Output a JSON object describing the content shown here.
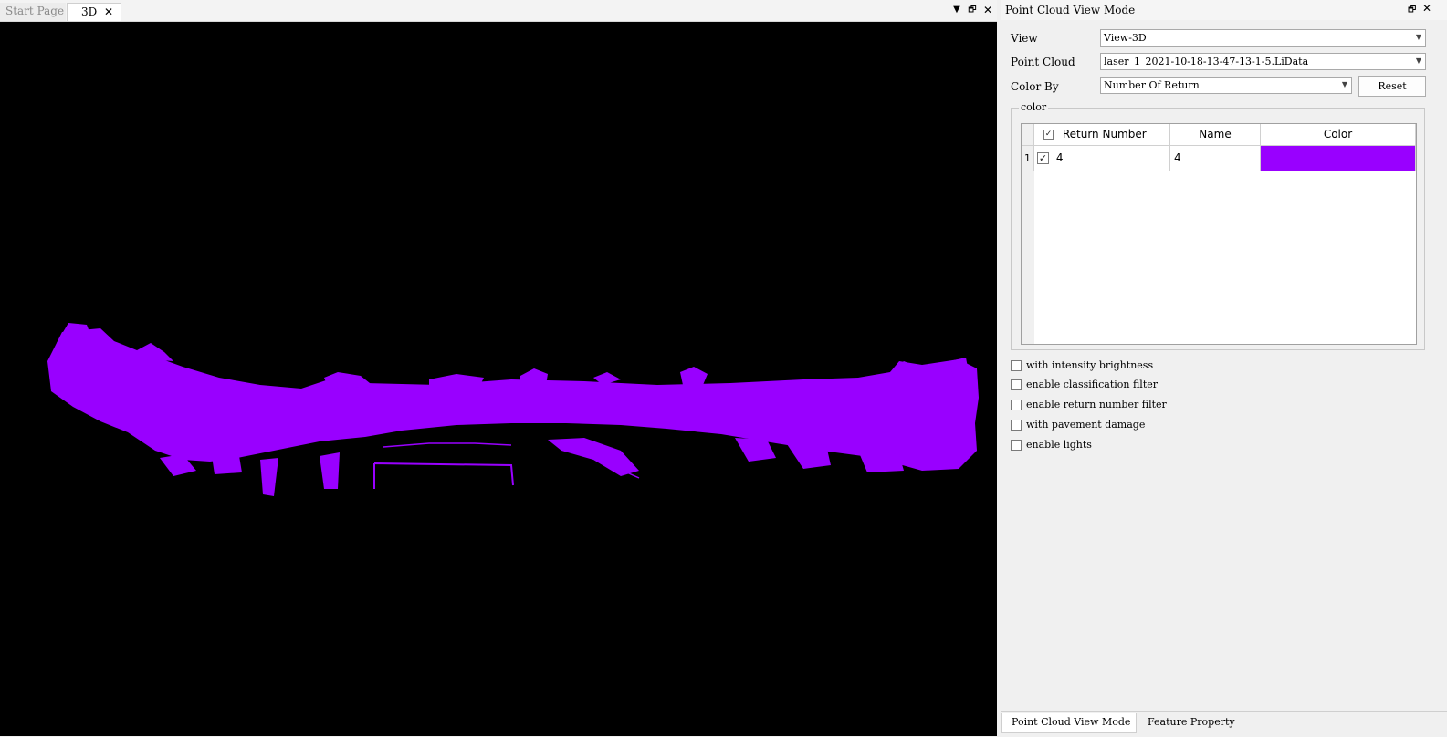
{
  "doc_tabs": [
    {
      "label": "Start Page",
      "active": false
    },
    {
      "label": "3D",
      "active": true
    }
  ],
  "doc_controls": {
    "dropdown_icon": "chevron-down-icon",
    "float_icon": "restore-window-icon",
    "close_icon": "close-icon"
  },
  "viewport": {
    "background": "#000000",
    "point_color": "#9900ff"
  },
  "panel": {
    "title": "Point Cloud View Mode",
    "view_label": "View",
    "view_value": "View-3D",
    "point_cloud_label": "Point Cloud",
    "point_cloud_value": "laser_1_2021-10-18-13-47-13-1-5.LiData",
    "color_by_label": "Color By",
    "color_by_value": "Number Of Return",
    "reset_label": "Reset",
    "color_group_label": "color",
    "table": {
      "headers": {
        "return_number": "Return Number",
        "name": "Name",
        "color": "Color"
      },
      "rows": [
        {
          "index": "1",
          "checked": true,
          "return_number": "4",
          "name": "4",
          "color": "#9900ff"
        }
      ]
    },
    "options": [
      {
        "label": "with intensity brightness",
        "checked": false
      },
      {
        "label": "enable classification filter",
        "checked": false
      },
      {
        "label": "enable return number filter",
        "checked": false
      },
      {
        "label": "with pavement damage",
        "checked": false
      },
      {
        "label": "enable lights",
        "checked": false
      }
    ]
  },
  "bottom_tabs": [
    {
      "label": "Point Cloud View Mode",
      "active": true
    },
    {
      "label": "Feature Property",
      "active": false
    }
  ]
}
